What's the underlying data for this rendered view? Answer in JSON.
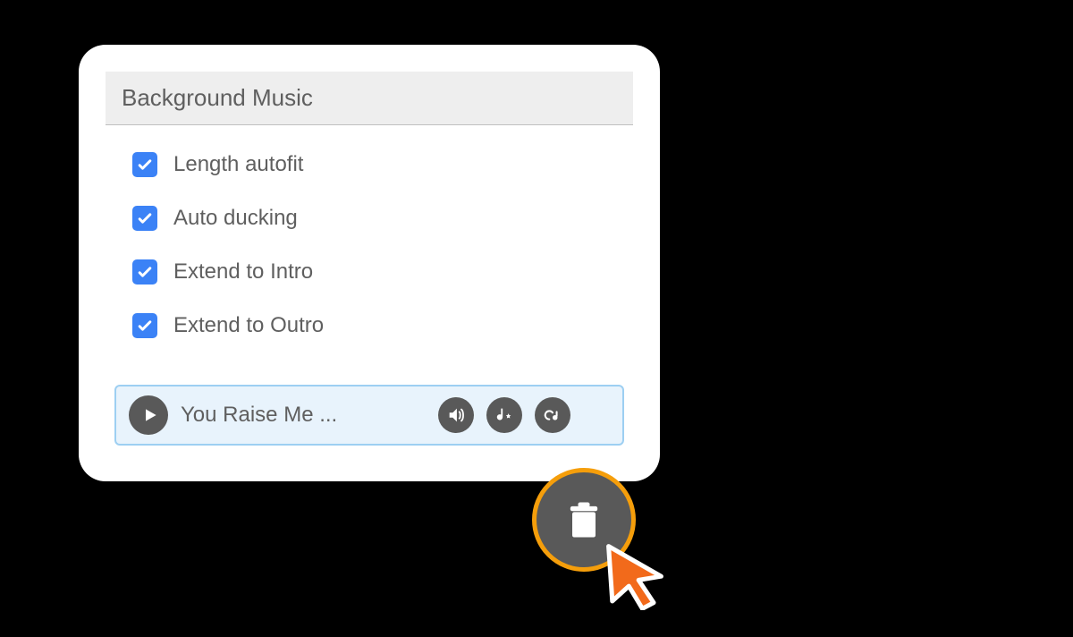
{
  "panel": {
    "title": "Background Music"
  },
  "options": [
    {
      "label": "Length autofit",
      "checked": true
    },
    {
      "label": "Auto ducking",
      "checked": true
    },
    {
      "label": "Extend to Intro",
      "checked": true
    },
    {
      "label": "Extend to Outro",
      "checked": true
    }
  ],
  "track": {
    "title": "You Raise Me ..."
  },
  "colors": {
    "accent_blue": "#3b82f6",
    "highlight_orange": "#f59e0b",
    "icon_bg": "#595959"
  }
}
